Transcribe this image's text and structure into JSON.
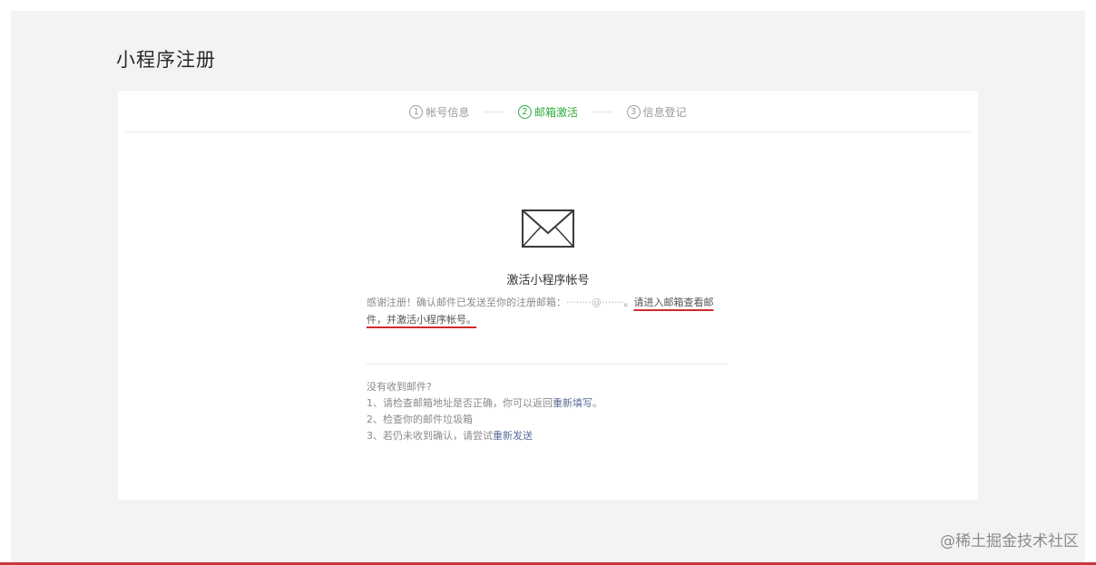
{
  "page": {
    "title": "小程序注册"
  },
  "steps": [
    {
      "num": "1",
      "label": "帐号信息",
      "active": false
    },
    {
      "num": "2",
      "label": "邮箱激活",
      "active": true
    },
    {
      "num": "3",
      "label": "信息登记",
      "active": false
    }
  ],
  "activation": {
    "icon": "envelope-icon",
    "title": "激活小程序帐号",
    "message_prefix": "感谢注册！确认邮件已发送至你的注册邮箱：",
    "email_masked": "········@·······",
    "message_separator": "。",
    "message_highlight": "请进入邮箱查看邮件，并激活小程序帐号。"
  },
  "help": {
    "heading": "没有收到邮件?",
    "item1_prefix": "1、请检查邮箱地址是否正确，你可以返回",
    "item1_link": "重新填写",
    "item1_suffix": "。",
    "item2": "2、检查你的邮件垃圾箱",
    "item3_prefix": "3、若仍未收到确认，请尝试",
    "item3_link": "重新发送"
  },
  "watermark": "@稀土掘金技术社区",
  "colors": {
    "accent_green": "#2bad3d",
    "link_blue": "#576b95",
    "highlight_underline": "#cf2a2a"
  }
}
